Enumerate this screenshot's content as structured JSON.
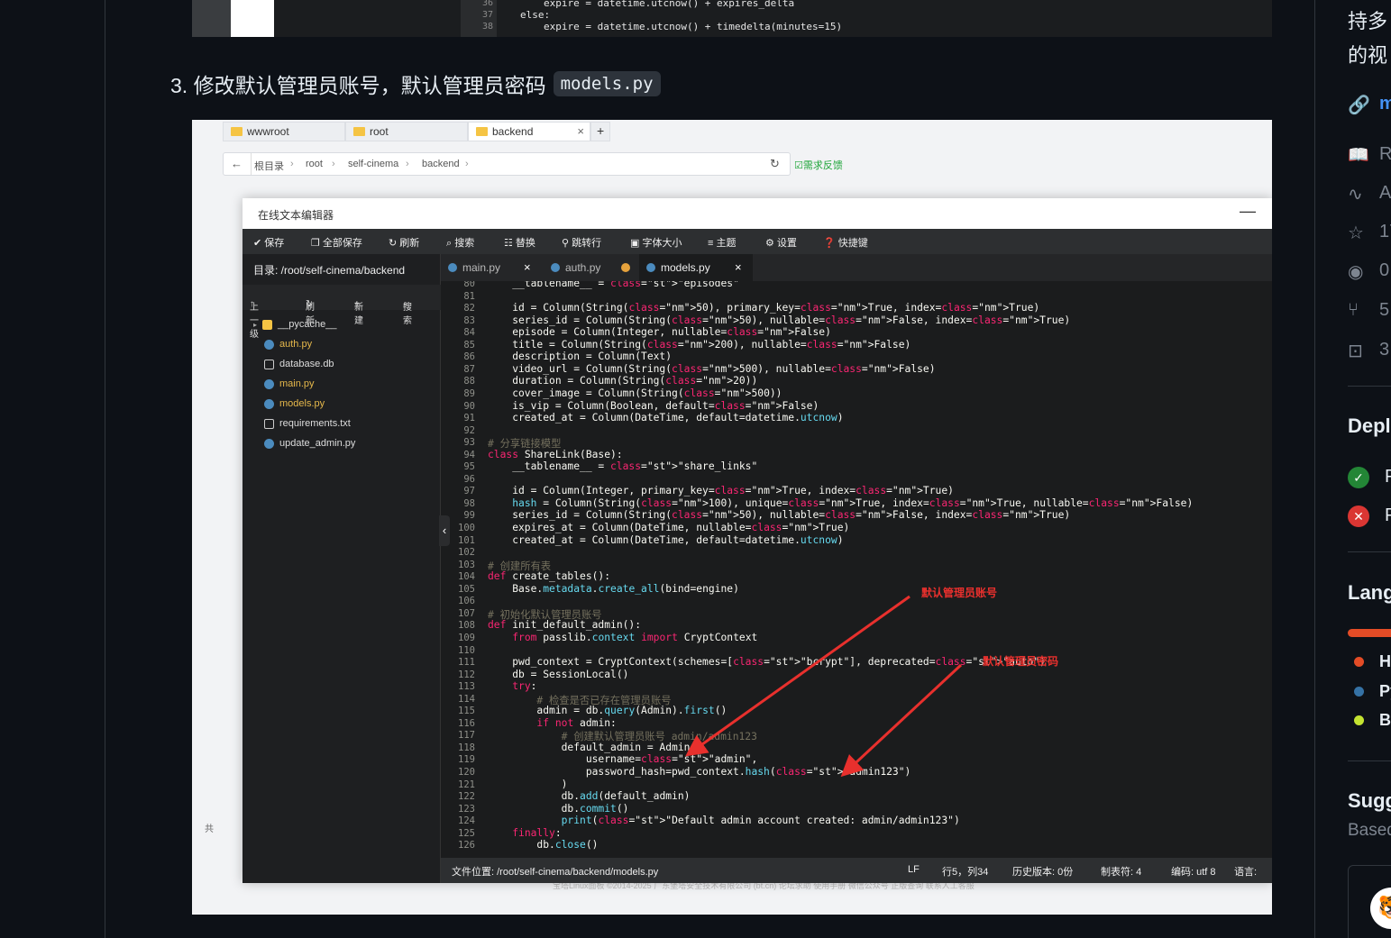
{
  "shot1": {
    "lines": [
      {
        "n": "36",
        "code": "expire = datetime.utcnow() + expires_delta"
      },
      {
        "n": "37",
        "code": "else:"
      },
      {
        "n": "38",
        "code": "expire = datetime.utcnow() + timedelta(minutes=15)"
      }
    ]
  },
  "step": {
    "text": "3. 修改默认管理员账号，默认管理员密码",
    "code": "models.py"
  },
  "panel": {
    "tabs": [
      "wwwroot",
      "root",
      "backend"
    ],
    "tab_add": "+",
    "tab_close": "×",
    "breadcrumb": [
      "根目录",
      "root",
      "self-cinema",
      "backend"
    ],
    "feedback": "需求反馈",
    "modal_title": "在线文本编辑器",
    "modal_close": "—",
    "toolbar": [
      "保存",
      "全部保存",
      "刷新",
      "搜索",
      "替换",
      "跳转行",
      "字体大小",
      "主题",
      "设置",
      "快捷键"
    ],
    "dir_label": "目录: /root/self-cinema/backend",
    "side_toolbar": [
      "上一级",
      "刷新",
      "新建",
      "搜索"
    ],
    "files": [
      "__pycache__",
      "auth.py",
      "database.db",
      "main.py",
      "models.py",
      "requirements.txt",
      "update_admin.py"
    ],
    "editor_tabs": [
      "main.py",
      "auth.py",
      "models.py"
    ],
    "status": {
      "path": "文件位置: /root/self-cinema/backend/models.py",
      "eol": "LF",
      "pos": "行5，列34",
      "history": "历史版本: 0份",
      "tab": "制表符: 4",
      "encoding": "编码: utf 8",
      "lang": "语言:"
    },
    "footer": "宝塔Linux面板 ©2014-2025 广东堡塔安全技术有限公司 (bt.cn)    论坛求助    使用手册    微信公众号    正版查询    联系人工客服",
    "side_co": "共",
    "annotations": {
      "account": "默认管理员账号",
      "password": "默认管理员密码"
    }
  },
  "code_lines": [
    {
      "n": "80",
      "code": "    __tablename__ = \"episodes\""
    },
    {
      "n": "81",
      "code": ""
    },
    {
      "n": "82",
      "code": "    id = Column(String(50), primary_key=True, index=True)"
    },
    {
      "n": "83",
      "code": "    series_id = Column(String(50), nullable=False, index=True)"
    },
    {
      "n": "84",
      "code": "    episode = Column(Integer, nullable=False)"
    },
    {
      "n": "85",
      "code": "    title = Column(String(200), nullable=False)"
    },
    {
      "n": "86",
      "code": "    description = Column(Text)"
    },
    {
      "n": "87",
      "code": "    video_url = Column(String(500), nullable=False)"
    },
    {
      "n": "88",
      "code": "    duration = Column(String(20))"
    },
    {
      "n": "89",
      "code": "    cover_image = Column(String(500))"
    },
    {
      "n": "90",
      "code": "    is_vip = Column(Boolean, default=False)"
    },
    {
      "n": "91",
      "code": "    created_at = Column(DateTime, default=datetime.utcnow)"
    },
    {
      "n": "92",
      "code": ""
    },
    {
      "n": "93",
      "code": "# 分享链接模型"
    },
    {
      "n": "94",
      "code": "class ShareLink(Base):"
    },
    {
      "n": "95",
      "code": "    __tablename__ = \"share_links\""
    },
    {
      "n": "96",
      "code": ""
    },
    {
      "n": "97",
      "code": "    id = Column(Integer, primary_key=True, index=True)"
    },
    {
      "n": "98",
      "code": "    hash = Column(String(100), unique=True, index=True, nullable=False)"
    },
    {
      "n": "99",
      "code": "    series_id = Column(String(50), nullable=False, index=True)"
    },
    {
      "n": "100",
      "code": "    expires_at = Column(DateTime, nullable=True)"
    },
    {
      "n": "101",
      "code": "    created_at = Column(DateTime, default=datetime.utcnow)"
    },
    {
      "n": "102",
      "code": ""
    },
    {
      "n": "103",
      "code": "# 创建所有表"
    },
    {
      "n": "104",
      "code": "def create_tables():"
    },
    {
      "n": "105",
      "code": "    Base.metadata.create_all(bind=engine)"
    },
    {
      "n": "106",
      "code": ""
    },
    {
      "n": "107",
      "code": "# 初始化默认管理员账号"
    },
    {
      "n": "108",
      "code": "def init_default_admin():"
    },
    {
      "n": "109",
      "code": "    from passlib.context import CryptContext"
    },
    {
      "n": "110",
      "code": ""
    },
    {
      "n": "111",
      "code": "    pwd_context = CryptContext(schemes=[\"bcrypt\"], deprecated=\"auto\")"
    },
    {
      "n": "112",
      "code": "    db = SessionLocal()"
    },
    {
      "n": "113",
      "code": "    try:"
    },
    {
      "n": "114",
      "code": "        # 检查是否已存在管理员账号"
    },
    {
      "n": "115",
      "code": "        admin = db.query(Admin).first()"
    },
    {
      "n": "116",
      "code": "        if not admin:"
    },
    {
      "n": "117",
      "code": "            # 创建默认管理员账号 admin/admin123"
    },
    {
      "n": "118",
      "code": "            default_admin = Admin("
    },
    {
      "n": "119",
      "code": "                username=\"admin\","
    },
    {
      "n": "120",
      "code": "                password_hash=pwd_context.hash(\"admin123\")"
    },
    {
      "n": "121",
      "code": "            )"
    },
    {
      "n": "122",
      "code": "            db.add(default_admin)"
    },
    {
      "n": "123",
      "code": "            db.commit()"
    },
    {
      "n": "124",
      "code": "            print(\"Default admin account created: admin/admin123\")"
    },
    {
      "n": "125",
      "code": "    finally:"
    },
    {
      "n": "126",
      "code": "        db.close()"
    }
  ],
  "right": {
    "top1": "持多",
    "top2": "的视",
    "link": "m",
    "stats": [
      "R",
      "A",
      "17",
      "0",
      "5",
      "3"
    ],
    "h_deploy": "Depl",
    "deploy": [
      "P",
      "P"
    ],
    "h_lang": "Lang",
    "langs": [
      "H",
      "Py",
      "B"
    ],
    "h_sugg": "Sugg",
    "sugg_sub": "Based"
  },
  "colors": {
    "accent": "#20a53a",
    "annotation": "#e8302d",
    "bg": "#0d1117",
    "editor_bg": "#1b1c1d"
  }
}
